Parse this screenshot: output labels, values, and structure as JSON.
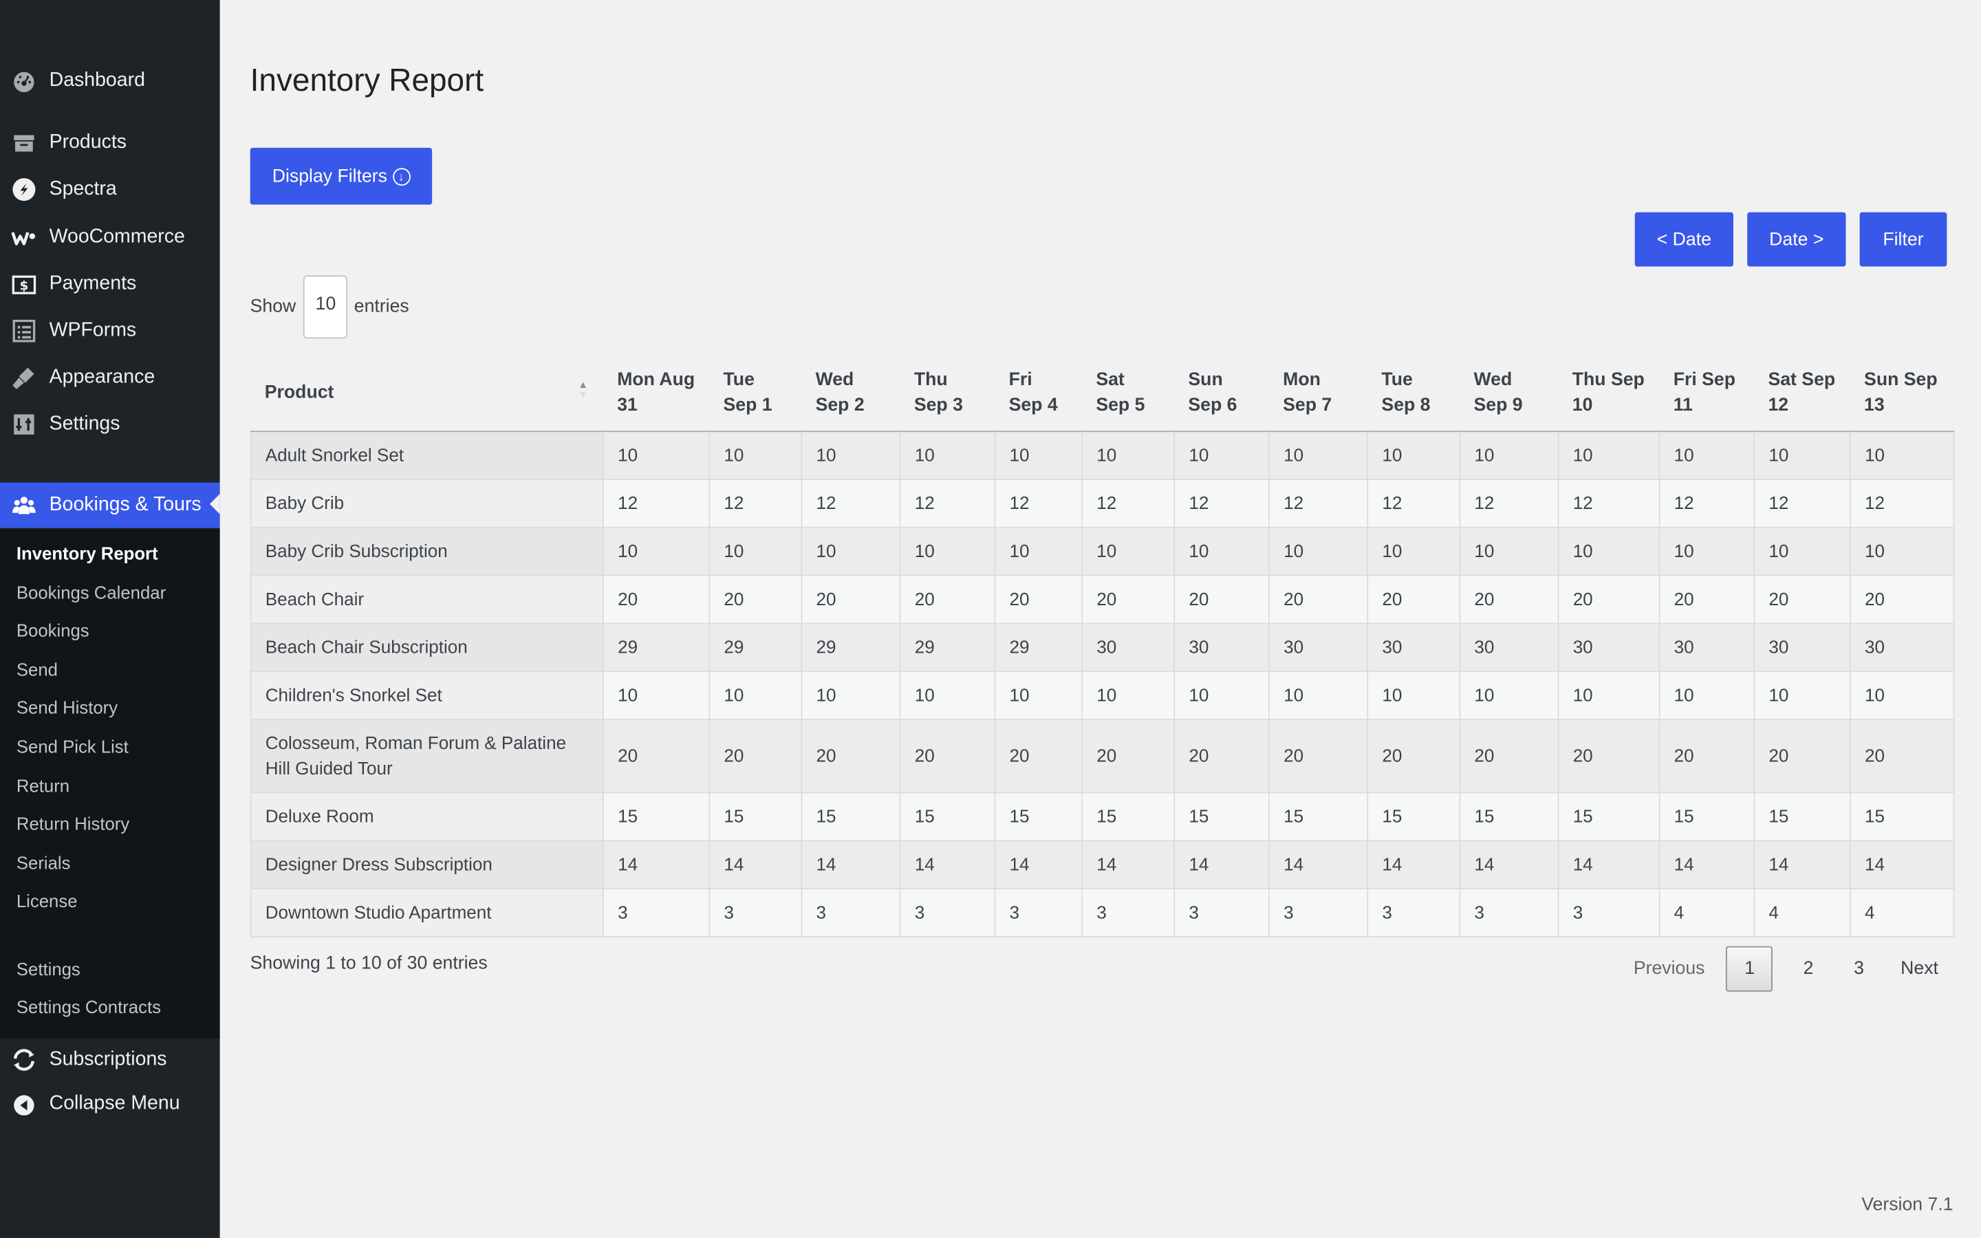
{
  "sidebar": {
    "menu": [
      {
        "label": "Dashboard",
        "icon": "dashboard-icon"
      },
      {
        "label": "Products",
        "icon": "products-icon"
      },
      {
        "label": "Spectra",
        "icon": "spectra-icon"
      },
      {
        "label": "WooCommerce",
        "icon": "woocommerce-icon"
      },
      {
        "label": "Payments",
        "icon": "payments-icon"
      },
      {
        "label": "WPForms",
        "icon": "wpforms-icon"
      },
      {
        "label": "Appearance",
        "icon": "appearance-icon"
      },
      {
        "label": "Settings",
        "icon": "settings-icon"
      },
      {
        "label": "Bookings & Tours",
        "icon": "bookings-icon"
      },
      {
        "label": "Subscriptions",
        "icon": "subscriptions-icon"
      },
      {
        "label": "Collapse Menu",
        "icon": "collapse-icon"
      }
    ],
    "submenu": [
      "Inventory Report",
      "Bookings Calendar",
      "Bookings",
      "Send",
      "Send History",
      "Send Pick List",
      "Return",
      "Return History",
      "Serials",
      "License",
      "Settings",
      "Settings Contracts"
    ],
    "accent_color": "#3858e9",
    "background_color": "#1d2327"
  },
  "page": {
    "title": "Inventory Report",
    "display_filters_label": "Display Filters",
    "date_prev_label": "< Date",
    "date_next_label": "Date >",
    "filter_label": "Filter",
    "show_label": "Show",
    "entries_value": "10",
    "entries_label": "entries",
    "info": "Showing 1 to 10 of 30 entries",
    "version": "Version 7.1"
  },
  "pagination": {
    "previous": "Previous",
    "pages": [
      "1",
      "2",
      "3"
    ],
    "current": "1",
    "next": "Next"
  },
  "table": {
    "product_header": "Product",
    "date_headers": [
      [
        "Mon Aug",
        "31"
      ],
      [
        "Tue",
        "Sep 1"
      ],
      [
        "Wed",
        "Sep 2"
      ],
      [
        "Thu",
        "Sep 3"
      ],
      [
        "Fri",
        "Sep 4"
      ],
      [
        "Sat",
        "Sep 5"
      ],
      [
        "Sun",
        "Sep 6"
      ],
      [
        "Mon",
        "Sep 7"
      ],
      [
        "Tue",
        "Sep 8"
      ],
      [
        "Wed",
        "Sep 9"
      ],
      [
        "Thu Sep",
        "10"
      ],
      [
        "Fri Sep",
        "11"
      ],
      [
        "Sat Sep",
        "12"
      ],
      [
        "Sun Sep",
        "13"
      ]
    ],
    "rows": [
      {
        "product": "Adult Snorkel Set",
        "values": [
          "10",
          "10",
          "10",
          "10",
          "10",
          "10",
          "10",
          "10",
          "10",
          "10",
          "10",
          "10",
          "10",
          "10"
        ]
      },
      {
        "product": "Baby Crib",
        "values": [
          "12",
          "12",
          "12",
          "12",
          "12",
          "12",
          "12",
          "12",
          "12",
          "12",
          "12",
          "12",
          "12",
          "12"
        ]
      },
      {
        "product": "Baby Crib Subscription",
        "values": [
          "10",
          "10",
          "10",
          "10",
          "10",
          "10",
          "10",
          "10",
          "10",
          "10",
          "10",
          "10",
          "10",
          "10"
        ]
      },
      {
        "product": "Beach Chair",
        "values": [
          "20",
          "20",
          "20",
          "20",
          "20",
          "20",
          "20",
          "20",
          "20",
          "20",
          "20",
          "20",
          "20",
          "20"
        ]
      },
      {
        "product": "Beach Chair Subscription",
        "values": [
          "29",
          "29",
          "29",
          "29",
          "29",
          "30",
          "30",
          "30",
          "30",
          "30",
          "30",
          "30",
          "30",
          "30"
        ]
      },
      {
        "product": "Children's Snorkel Set",
        "values": [
          "10",
          "10",
          "10",
          "10",
          "10",
          "10",
          "10",
          "10",
          "10",
          "10",
          "10",
          "10",
          "10",
          "10"
        ]
      },
      {
        "product": "Colosseum, Roman Forum & Palatine Hill Guided Tour",
        "values": [
          "20",
          "20",
          "20",
          "20",
          "20",
          "20",
          "20",
          "20",
          "20",
          "20",
          "20",
          "20",
          "20",
          "20"
        ]
      },
      {
        "product": "Deluxe Room",
        "values": [
          "15",
          "15",
          "15",
          "15",
          "15",
          "15",
          "15",
          "15",
          "15",
          "15",
          "15",
          "15",
          "15",
          "15"
        ]
      },
      {
        "product": "Designer Dress Subscription",
        "values": [
          "14",
          "14",
          "14",
          "14",
          "14",
          "14",
          "14",
          "14",
          "14",
          "14",
          "14",
          "14",
          "14",
          "14"
        ]
      },
      {
        "product": "Downtown Studio Apartment",
        "values": [
          "3",
          "3",
          "3",
          "3",
          "3",
          "3",
          "3",
          "3",
          "3",
          "3",
          "3",
          "4",
          "4",
          "4"
        ]
      }
    ]
  }
}
